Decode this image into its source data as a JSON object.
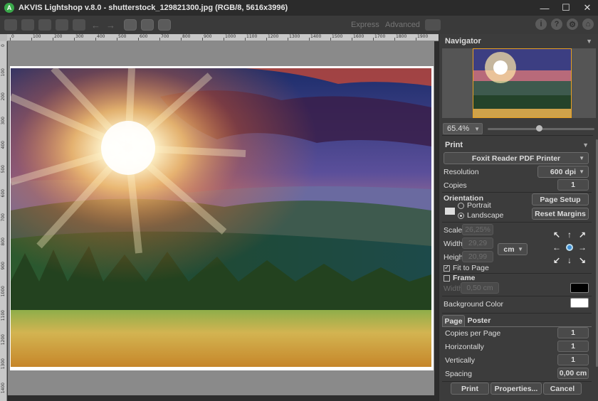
{
  "window": {
    "title": "AKVIS Lightshop v.8.0 - shutterstock_129821300.jpg (RGB/8, 5616x3996)",
    "controls": [
      "—",
      "☐",
      "✕"
    ]
  },
  "toolbar": {
    "modes": [
      "Express",
      "Advanced"
    ],
    "right_icons": [
      "i",
      "?",
      "⚙",
      "⌂"
    ]
  },
  "ruler": {
    "top_labels": [
      "0",
      "100",
      "200",
      "300",
      "400",
      "500",
      "600",
      "700",
      "800",
      "900",
      "1000",
      "1100",
      "1200",
      "1300",
      "1400",
      "1500",
      "1600",
      "1700",
      "1800",
      "1900",
      "2000"
    ],
    "left_labels": [
      "0",
      "100",
      "200",
      "300",
      "400",
      "500",
      "600",
      "700",
      "800",
      "900",
      "1000",
      "1100",
      "1200",
      "1300",
      "1400"
    ]
  },
  "navigator": {
    "title": "Navigator",
    "zoom": "65.4%",
    "zoom_level": 0.48
  },
  "print": {
    "title": "Print",
    "printer": "Foxit Reader PDF Printer",
    "resolution_label": "Resolution",
    "resolution": "600 dpi",
    "copies_label": "Copies",
    "copies": "1",
    "orientation_label": "Orientation",
    "portrait": "Portrait",
    "landscape": "Landscape",
    "page_setup": "Page Setup",
    "reset_margins": "Reset Margins",
    "scale_label": "Scale",
    "scale": "26,25%",
    "width_label": "Width",
    "width": "29,29",
    "height_label": "Height",
    "height": "20,99",
    "unit": "cm",
    "fit_to_page": "Fit to Page",
    "frame": "Frame",
    "frame_width_label": "Width",
    "frame_width": "0,50 cm",
    "frame_color": "#000000",
    "background_color_label": "Background Color",
    "background_color": "#ffffff"
  },
  "page_tabs": {
    "tabs": [
      "Page",
      "Poster"
    ],
    "copies_per_page_label": "Copies per Page",
    "copies_per_page": "1",
    "horizontally_label": "Horizontally",
    "horizontally": "1",
    "vertically_label": "Vertically",
    "vertically": "1",
    "spacing_label": "Spacing",
    "spacing": "0,00 cm"
  },
  "actions": {
    "print": "Print",
    "properties": "Properties...",
    "cancel": "Cancel"
  }
}
